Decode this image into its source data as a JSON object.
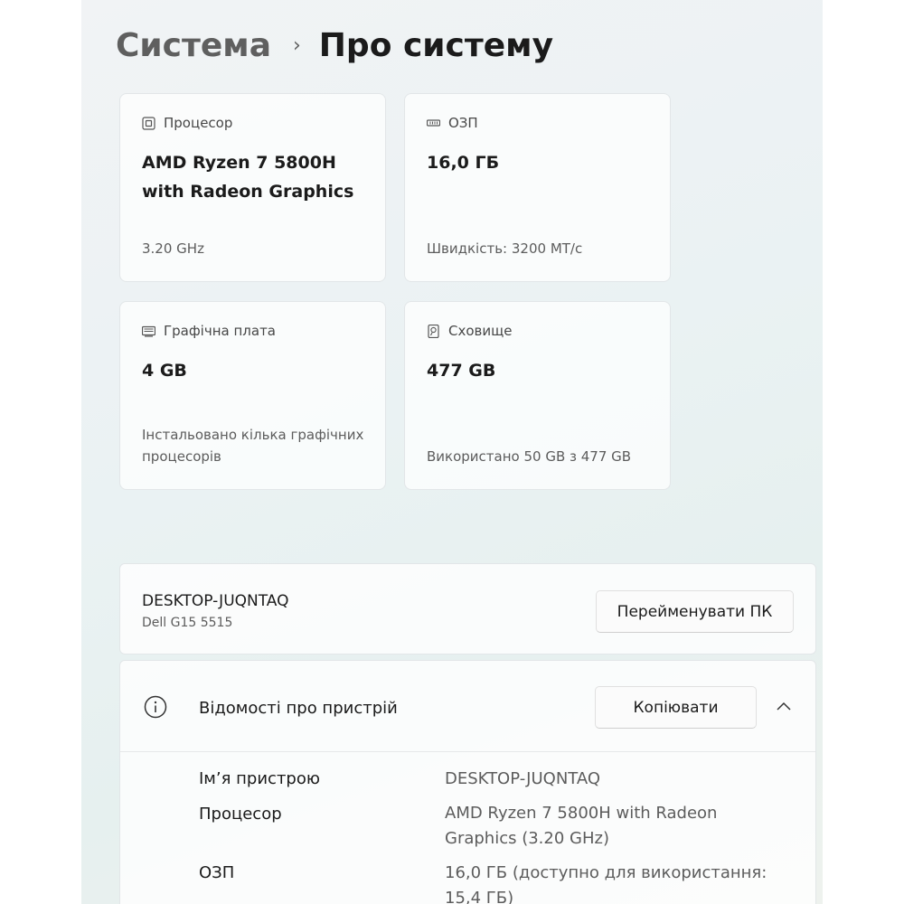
{
  "breadcrumb": {
    "parent": "Система",
    "separator": "›",
    "current": "Про систему"
  },
  "cards": {
    "processor": {
      "icon": "cpu-chip-icon",
      "label": "Процесор",
      "value": "AMD Ryzen 7 5800H with Radeon Graphics",
      "sub": "3.20 GHz"
    },
    "ram": {
      "icon": "memory-module-icon",
      "label": "ОЗП",
      "value": "16,0 ГБ",
      "sub": "Швидкість: 3200 МТ/с"
    },
    "graphics": {
      "icon": "graphics-card-icon",
      "label": "Графічна плата",
      "value": "4 GB",
      "sub": "Інстальовано кілька графічних процесорів"
    },
    "storage": {
      "icon": "storage-drive-icon",
      "label": "Сховище",
      "value": "477 GB",
      "sub": "Використано 50 GB з 477 GB"
    }
  },
  "pc": {
    "name": "DESKTOP-JUQNTAQ",
    "model": "Dell G15 5515",
    "rename_label": "Перейменувати ПК"
  },
  "device_specs": {
    "icon": "info-circle-icon",
    "title": "Відомості про пристрій",
    "copy_label": "Копіювати",
    "collapse_icon": "chevron-up-icon",
    "rows": [
      {
        "label": "Ім’я пристрою",
        "value": "DESKTOP-JUQNTAQ"
      },
      {
        "label": "Процесор",
        "value": "AMD Ryzen 7 5800H with Radeon Graphics (3.20 GHz)"
      },
      {
        "label": "ОЗП",
        "value": "16,0 ГБ (доступно для використання: 15,4 ГБ)"
      }
    ]
  }
}
